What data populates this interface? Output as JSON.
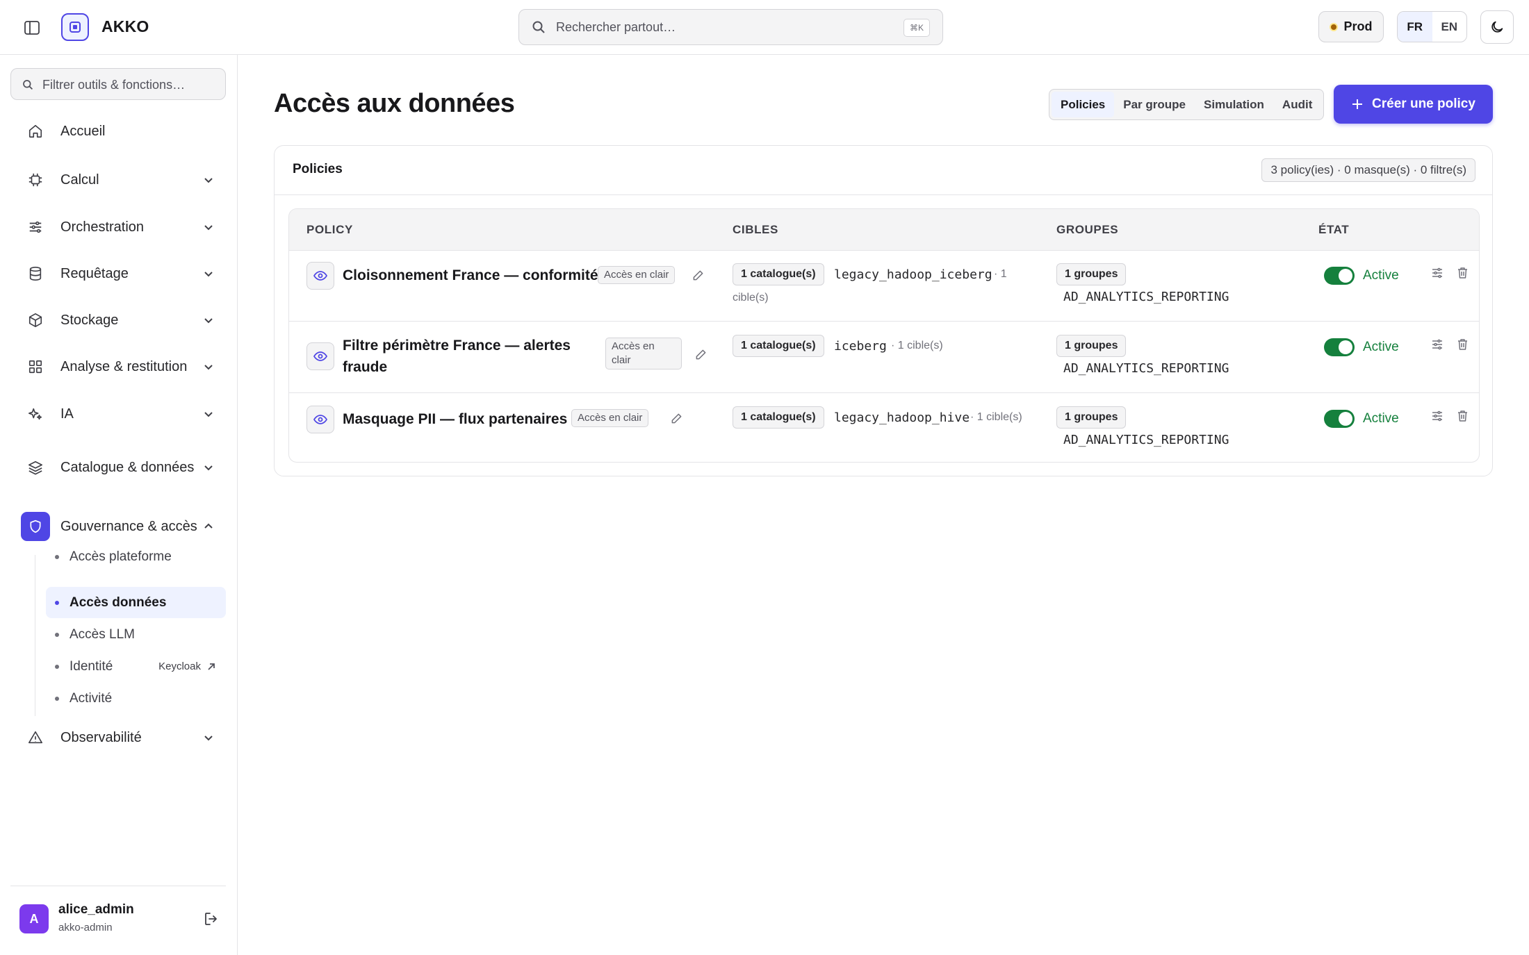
{
  "app": {
    "name": "AKKO"
  },
  "search": {
    "placeholder": "Rechercher partout…",
    "shortcut": "⌘K"
  },
  "env": {
    "label": "Prod"
  },
  "lang": {
    "options": [
      "FR",
      "EN"
    ],
    "selected": "FR"
  },
  "sidebar": {
    "filter_placeholder": "Filtrer outils & fonctions…",
    "items": [
      {
        "label": "Accueil",
        "icon": "home-icon"
      },
      {
        "label": "Calcul",
        "icon": "cpu-icon"
      },
      {
        "label": "Orchestration",
        "icon": "sliders-icon"
      },
      {
        "label": "Requêtage",
        "icon": "database-icon"
      },
      {
        "label": "Stockage",
        "icon": "box-icon"
      },
      {
        "label": "Analyse & restitution",
        "icon": "grid-icon"
      },
      {
        "label": "IA",
        "icon": "sparkles-icon"
      },
      {
        "label": "Catalogue & données",
        "icon": "layers-icon"
      },
      {
        "label": "Gouvernance & accès",
        "icon": "shield-icon"
      },
      {
        "label": "Observabilité",
        "icon": "alert-triangle-icon"
      }
    ],
    "subitems": [
      {
        "label": "Accès plateforme"
      },
      {
        "label": "Accès données"
      },
      {
        "label": "Accès LLM"
      },
      {
        "label": "Identité",
        "extra": "Keycloak"
      },
      {
        "label": "Activité"
      }
    ],
    "user": {
      "initial": "A",
      "name": "alice_admin",
      "role": "akko-admin"
    }
  },
  "main": {
    "title": "Accès aux données",
    "tabs": [
      "Policies",
      "Par groupe",
      "Simulation",
      "Audit"
    ],
    "active_tab": "Policies",
    "create_label": "Créer une policy",
    "card": {
      "title": "Policies",
      "summary": "3 policy(ies) · 0 masque(s) · 0 filtre(s)",
      "columns": [
        "POLICY",
        "CIBLES",
        "GROUPES",
        "ÉTAT"
      ],
      "rows": [
        {
          "name": "Cloisonnement France — conformité",
          "access_tag": "Accès en clair",
          "catalog_chip": "1 catalogue(s)",
          "target": "legacy_hadoop_iceberg",
          "target_note": "· 1 cible(s)",
          "group_chip": "1 groupes",
          "group": "AD_ANALYTICS_REPORTING",
          "state": "Active"
        },
        {
          "name": "Filtre périmètre France — alertes fraude",
          "access_tag": "Accès en clair",
          "catalog_chip": "1 catalogue(s)",
          "target": "iceberg",
          "target_note": "· 1 cible(s)",
          "group_chip": "1 groupes",
          "group": "AD_ANALYTICS_REPORTING",
          "state": "Active"
        },
        {
          "name": "Masquage PII — flux partenaires",
          "access_tag": "Accès en clair",
          "catalog_chip": "1 catalogue(s)",
          "target": "legacy_hadoop_hive",
          "target_note": "· 1 cible(s)",
          "group_chip": "1 groupes",
          "group": "AD_ANALYTICS_REPORTING",
          "state": "Active"
        }
      ]
    }
  },
  "colors": {
    "accent": "#4f46e5",
    "success": "#15803d"
  }
}
